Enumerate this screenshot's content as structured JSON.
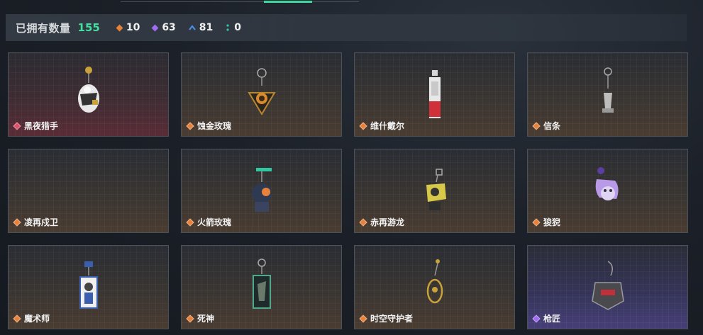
{
  "summary": {
    "label": "已拥有数量",
    "total": "155",
    "rarities": [
      {
        "icon": "orange-gem-icon",
        "color": "#e8823a",
        "count": "10"
      },
      {
        "icon": "purple-gem-icon",
        "color": "#a06bf0",
        "count": "63"
      },
      {
        "icon": "blue-chevron-icon",
        "color": "#4a90e2",
        "count": "81"
      },
      {
        "icon": "teal-dots-icon",
        "color": "#30c8a8",
        "count": "0"
      }
    ]
  },
  "colors": {
    "accent": "#3fd6a0",
    "rarity_orange": "#e8823a",
    "rarity_red": "#e0506a",
    "rarity_purple": "#a06bf0"
  },
  "cards": [
    {
      "name": "黑夜猎手",
      "rarity": "red",
      "icon": "night-hunter-charm-icon"
    },
    {
      "name": "蚀金玫瑰",
      "rarity": "orange",
      "icon": "gilded-rose-charm-icon"
    },
    {
      "name": "维什戴尔",
      "rarity": "orange",
      "icon": "wisadel-charm-icon"
    },
    {
      "name": "信条",
      "rarity": "orange",
      "icon": "creed-charm-icon"
    },
    {
      "name": "凌再戍卫",
      "rarity": "orange",
      "icon": "guard-charm-icon"
    },
    {
      "name": "火箭玫瑰",
      "rarity": "orange",
      "icon": "rocket-rose-charm-icon"
    },
    {
      "name": "赤再游龙",
      "rarity": "orange",
      "icon": "red-dragon-charm-icon"
    },
    {
      "name": "狻猊",
      "rarity": "orange",
      "icon": "suanni-charm-icon"
    },
    {
      "name": "魔术师",
      "rarity": "orange",
      "icon": "magician-charm-icon"
    },
    {
      "name": "死神",
      "rarity": "orange",
      "icon": "reaper-charm-icon"
    },
    {
      "name": "时空守护者",
      "rarity": "orange",
      "icon": "time-guardian-charm-icon"
    },
    {
      "name": "枪匠",
      "rarity": "purple",
      "icon": "gunsmith-charm-icon"
    }
  ]
}
